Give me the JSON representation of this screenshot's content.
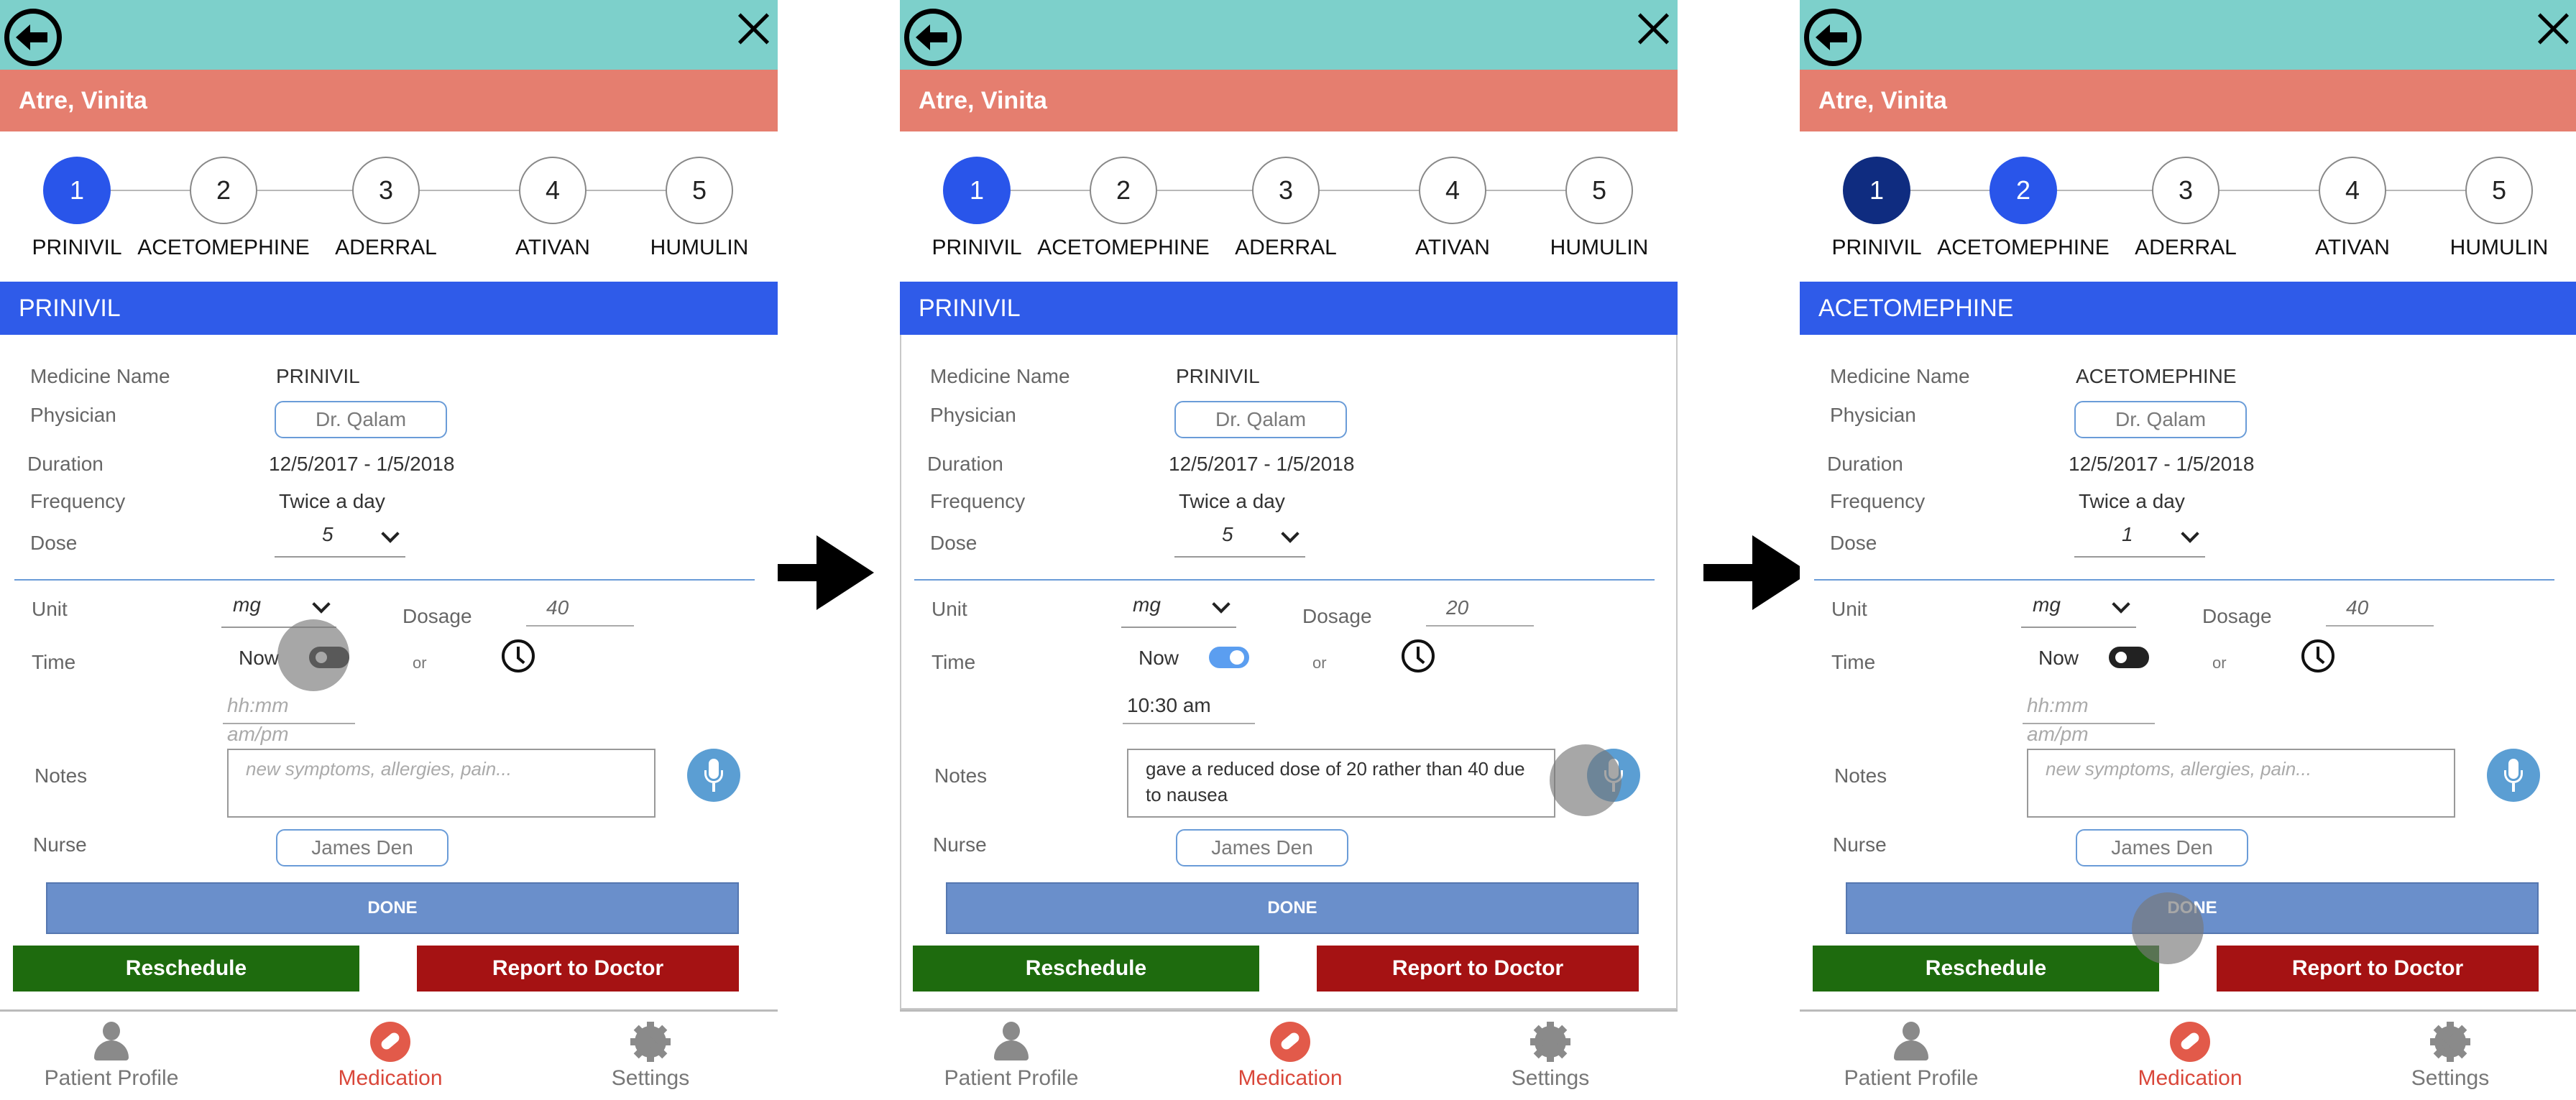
{
  "screens": [
    {
      "patient_name": "Atre, Vinita",
      "steps": [
        {
          "number": "1",
          "label": "PRINIVIL",
          "state": "active"
        },
        {
          "number": "2",
          "label": "ACETOMEPHINE",
          "state": "pending"
        },
        {
          "number": "3",
          "label": "ADERRAL",
          "state": "pending"
        },
        {
          "number": "4",
          "label": "ATIVAN",
          "state": "pending"
        },
        {
          "number": "5",
          "label": "HUMULIN",
          "state": "pending"
        }
      ],
      "section_title": "PRINIVIL",
      "medicine_name_label": "Medicine Name",
      "medicine_name": "PRINIVIL",
      "physician_label": "Physician",
      "physician": "Dr. Qalam",
      "duration_label": "Duration",
      "duration": "12/5/2017 - 1/5/2018",
      "frequency_label": "Frequency",
      "frequency": "Twice a day",
      "dose_label": "Dose",
      "dose": "5",
      "unit_label": "Unit",
      "unit": "mg",
      "dosage_label": "Dosage",
      "dosage": "40",
      "time_label": "Time",
      "now_label": "Now",
      "now_on": false,
      "or_label": "or",
      "time_value": "",
      "time_placeholder": "hh:mm am/pm",
      "notes_label": "Notes",
      "notes_value": "",
      "notes_placeholder": "new symptoms, allergies, pain...",
      "nurse_label": "Nurse",
      "nurse": "James Den",
      "done_label": "DONE",
      "reschedule_label": "Reschedule",
      "report_label": "Report to Doctor"
    },
    {
      "patient_name": "Atre, Vinita",
      "steps": [
        {
          "number": "1",
          "label": "PRINIVIL",
          "state": "active"
        },
        {
          "number": "2",
          "label": "ACETOMEPHINE",
          "state": "pending"
        },
        {
          "number": "3",
          "label": "ADERRAL",
          "state": "pending"
        },
        {
          "number": "4",
          "label": "ATIVAN",
          "state": "pending"
        },
        {
          "number": "5",
          "label": "HUMULIN",
          "state": "pending"
        }
      ],
      "section_title": "PRINIVIL",
      "medicine_name_label": "Medicine Name",
      "medicine_name": "PRINIVIL",
      "physician_label": "Physician",
      "physician": "Dr. Qalam",
      "duration_label": "Duration",
      "duration": "12/5/2017 - 1/5/2018",
      "frequency_label": "Frequency",
      "frequency": "Twice a day",
      "dose_label": "Dose",
      "dose": "5",
      "unit_label": "Unit",
      "unit": "mg",
      "dosage_label": "Dosage",
      "dosage": "20",
      "time_label": "Time",
      "now_label": "Now",
      "now_on": true,
      "or_label": "or",
      "time_value": "10:30 am",
      "time_placeholder": "",
      "notes_label": "Notes",
      "notes_value": "gave  a reduced dose of 20 rather than 40 due to nausea",
      "notes_placeholder": "",
      "nurse_label": "Nurse",
      "nurse": "James Den",
      "done_label": "DONE",
      "reschedule_label": "Reschedule",
      "report_label": "Report to Doctor"
    },
    {
      "patient_name": "Atre, Vinita",
      "steps": [
        {
          "number": "1",
          "label": "PRINIVIL",
          "state": "done"
        },
        {
          "number": "2",
          "label": "ACETOMEPHINE",
          "state": "active"
        },
        {
          "number": "3",
          "label": "ADERRAL",
          "state": "pending"
        },
        {
          "number": "4",
          "label": "ATIVAN",
          "state": "pending"
        },
        {
          "number": "5",
          "label": "HUMULIN",
          "state": "pending"
        }
      ],
      "section_title": "ACETOMEPHINE",
      "medicine_name_label": "Medicine Name",
      "medicine_name": "ACETOMEPHINE",
      "physician_label": "Physician",
      "physician": "Dr. Qalam",
      "duration_label": "Duration",
      "duration": "12/5/2017 - 1/5/2018",
      "frequency_label": "Frequency",
      "frequency": "Twice a day",
      "dose_label": "Dose",
      "dose": "1",
      "unit_label": "Unit",
      "unit": "mg",
      "dosage_label": "Dosage",
      "dosage": "40",
      "time_label": "Time",
      "now_label": "Now",
      "now_on": false,
      "or_label": "or",
      "time_value": "",
      "time_placeholder": "hh:mm am/pm",
      "notes_label": "Notes",
      "notes_value": "",
      "notes_placeholder": "new symptoms, allergies, pain...",
      "nurse_label": "Nurse",
      "nurse": "James Den",
      "done_label": "DONE",
      "reschedule_label": "Reschedule",
      "report_label": "Report to Doctor"
    }
  ],
  "nav": {
    "patient_profile": "Patient Profile",
    "medication": "Medication",
    "settings": "Settings"
  },
  "colors": {
    "topbar": "#7dd0cb",
    "patient_bar": "#e57e6f",
    "section_bar": "#2f5be9",
    "step_active": "#2955ea",
    "step_done": "#0f2c80",
    "reschedule": "#1e6b0e",
    "report": "#a51213",
    "done": "#6a8fcb"
  }
}
